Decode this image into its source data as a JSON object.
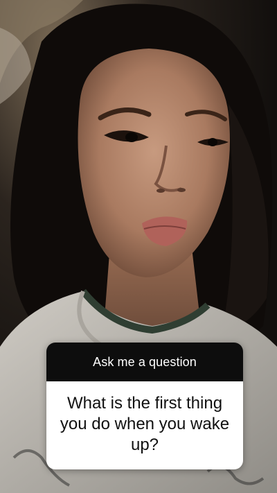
{
  "story": {
    "question_sticker": {
      "prompt": "Ask me a question",
      "question": "What is the first thing you do when you wake up?"
    }
  },
  "colors": {
    "sticker_header_bg": "#0d0d0d",
    "sticker_body_bg": "#ffffff",
    "sticker_header_text": "#ffffff",
    "sticker_body_text": "#111111"
  }
}
